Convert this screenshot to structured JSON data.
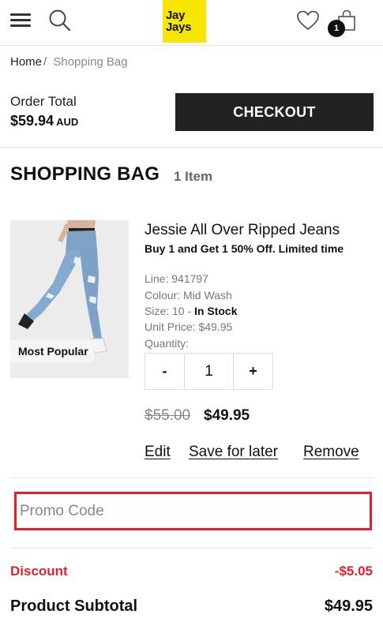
{
  "header": {
    "logo_line1": "Jay",
    "logo_line2": "Jays",
    "bag_count": "1",
    "brand_color": "#f7e600"
  },
  "breadcrumb": {
    "home": "Home",
    "separator": "/",
    "current": "Shopping Bag"
  },
  "order_summary": {
    "label": "Order Total",
    "amount": "$59.94",
    "currency": "AUD",
    "checkout_label": "CHECKOUT"
  },
  "bag": {
    "title": "SHOPPING BAG",
    "item_count": "1 Item"
  },
  "product": {
    "badge": "Most Popular",
    "name": "Jessie All Over Ripped Jeans",
    "promo": "Buy 1 and Get 1 50% Off. Limited time",
    "line": "Line: 941797",
    "colour": "Colour: Mid Wash",
    "size_prefix": "Size: 10 - ",
    "stock": "In Stock",
    "unit_price": "Unit Price: $49.95",
    "quantity_label": "Quantity:",
    "decrement": "-",
    "quantity": "1",
    "increment": "+",
    "old_price": "$55.00",
    "price": "$49.95",
    "actions": {
      "edit": "Edit",
      "save": "Save for later",
      "remove": "Remove"
    }
  },
  "promo": {
    "placeholder": "Promo Code",
    "value": "",
    "highlight_color": "#e0202a"
  },
  "totals": {
    "discount_label": "Discount",
    "discount_value": "-$5.05",
    "subtotal_label": "Product Subtotal",
    "subtotal_value": "$49.95"
  },
  "icons": [
    "hamburger-icon",
    "search-icon",
    "heart-icon",
    "shopping-bag-icon"
  ]
}
